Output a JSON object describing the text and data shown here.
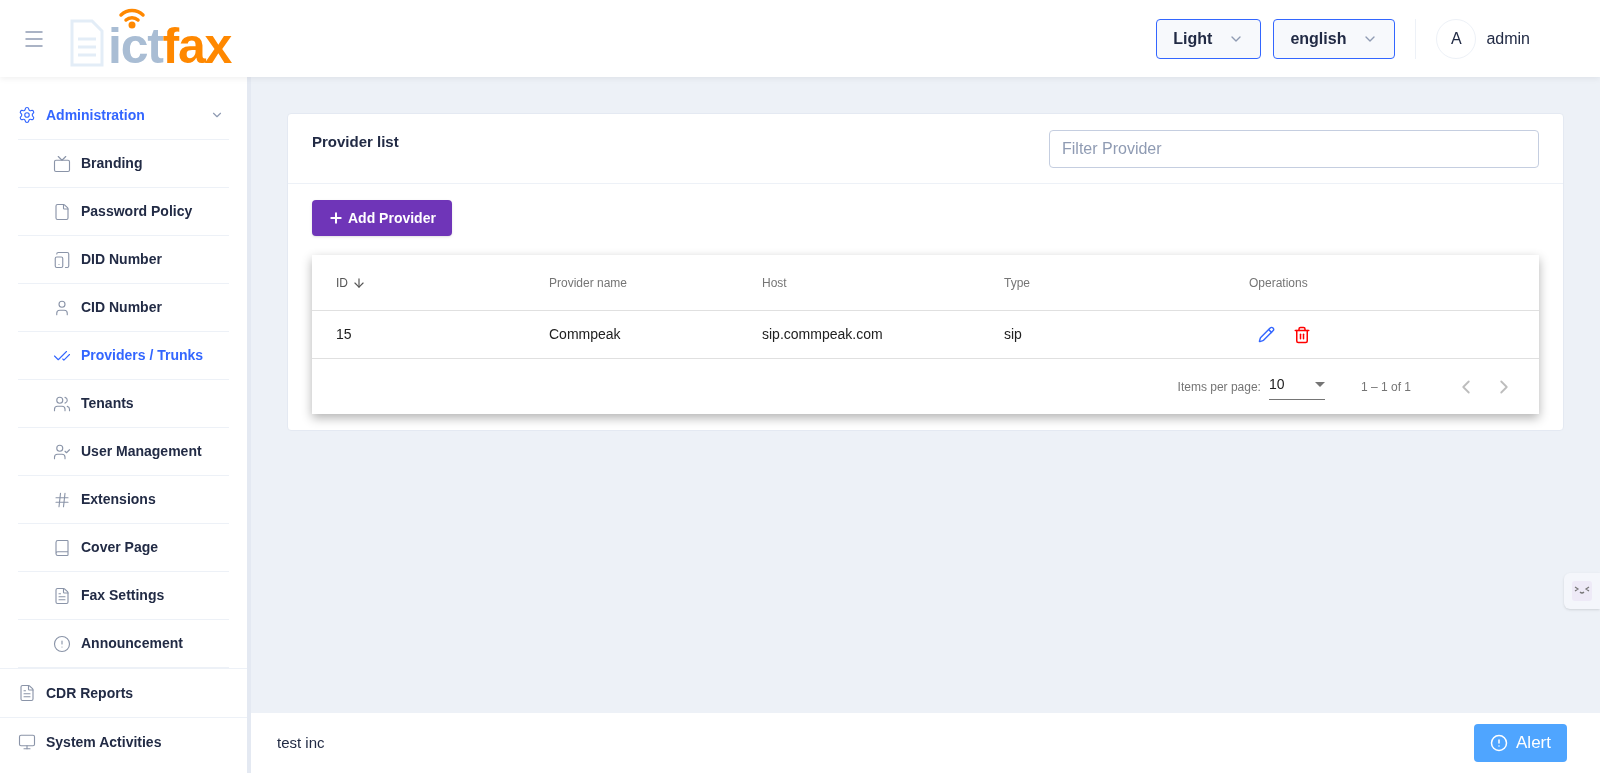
{
  "header": {
    "logo": {
      "faint": "ict",
      "accent": "fax"
    },
    "theme_select": {
      "value": "Light"
    },
    "language_select": {
      "value": "english"
    },
    "user": {
      "initial": "A",
      "name": "admin"
    }
  },
  "sidebar": {
    "items": [
      {
        "label": "Administration",
        "selected": false,
        "expanded": true,
        "children": [
          {
            "label": "Branding",
            "selected": false
          },
          {
            "label": "Password Policy",
            "selected": false
          },
          {
            "label": "DID Number",
            "selected": false
          },
          {
            "label": "CID Number",
            "selected": false
          },
          {
            "label": "Providers / Trunks",
            "selected": true
          },
          {
            "label": "Tenants",
            "selected": false
          },
          {
            "label": "User Management",
            "selected": false
          },
          {
            "label": "Extensions",
            "selected": false
          },
          {
            "label": "Cover Page",
            "selected": false
          },
          {
            "label": "Fax Settings",
            "selected": false
          },
          {
            "label": "Announcement",
            "selected": false
          }
        ]
      },
      {
        "label": "CDR Reports",
        "selected": false
      },
      {
        "label": "System Activities",
        "selected": false
      }
    ]
  },
  "card": {
    "title": "Provider list",
    "filter": {
      "placeholder": "Filter Provider"
    },
    "add_button": "Add Provider",
    "table": {
      "columns": [
        {
          "label": "ID",
          "sorted": true
        },
        {
          "label": "Provider name",
          "sorted": false
        },
        {
          "label": "Host",
          "sorted": false
        },
        {
          "label": "Type",
          "sorted": false
        },
        {
          "label": "Operations",
          "sorted": false
        }
      ],
      "rows": [
        {
          "id": "15",
          "name": "Commpeak",
          "host": "sip.commpeak.com",
          "type": "sip"
        }
      ],
      "paginator": {
        "label": "Items per page:",
        "page_size": "10",
        "range": "1 – 1 of 1"
      }
    }
  },
  "footer": {
    "text": "test inc",
    "alert_button": "Alert"
  }
}
